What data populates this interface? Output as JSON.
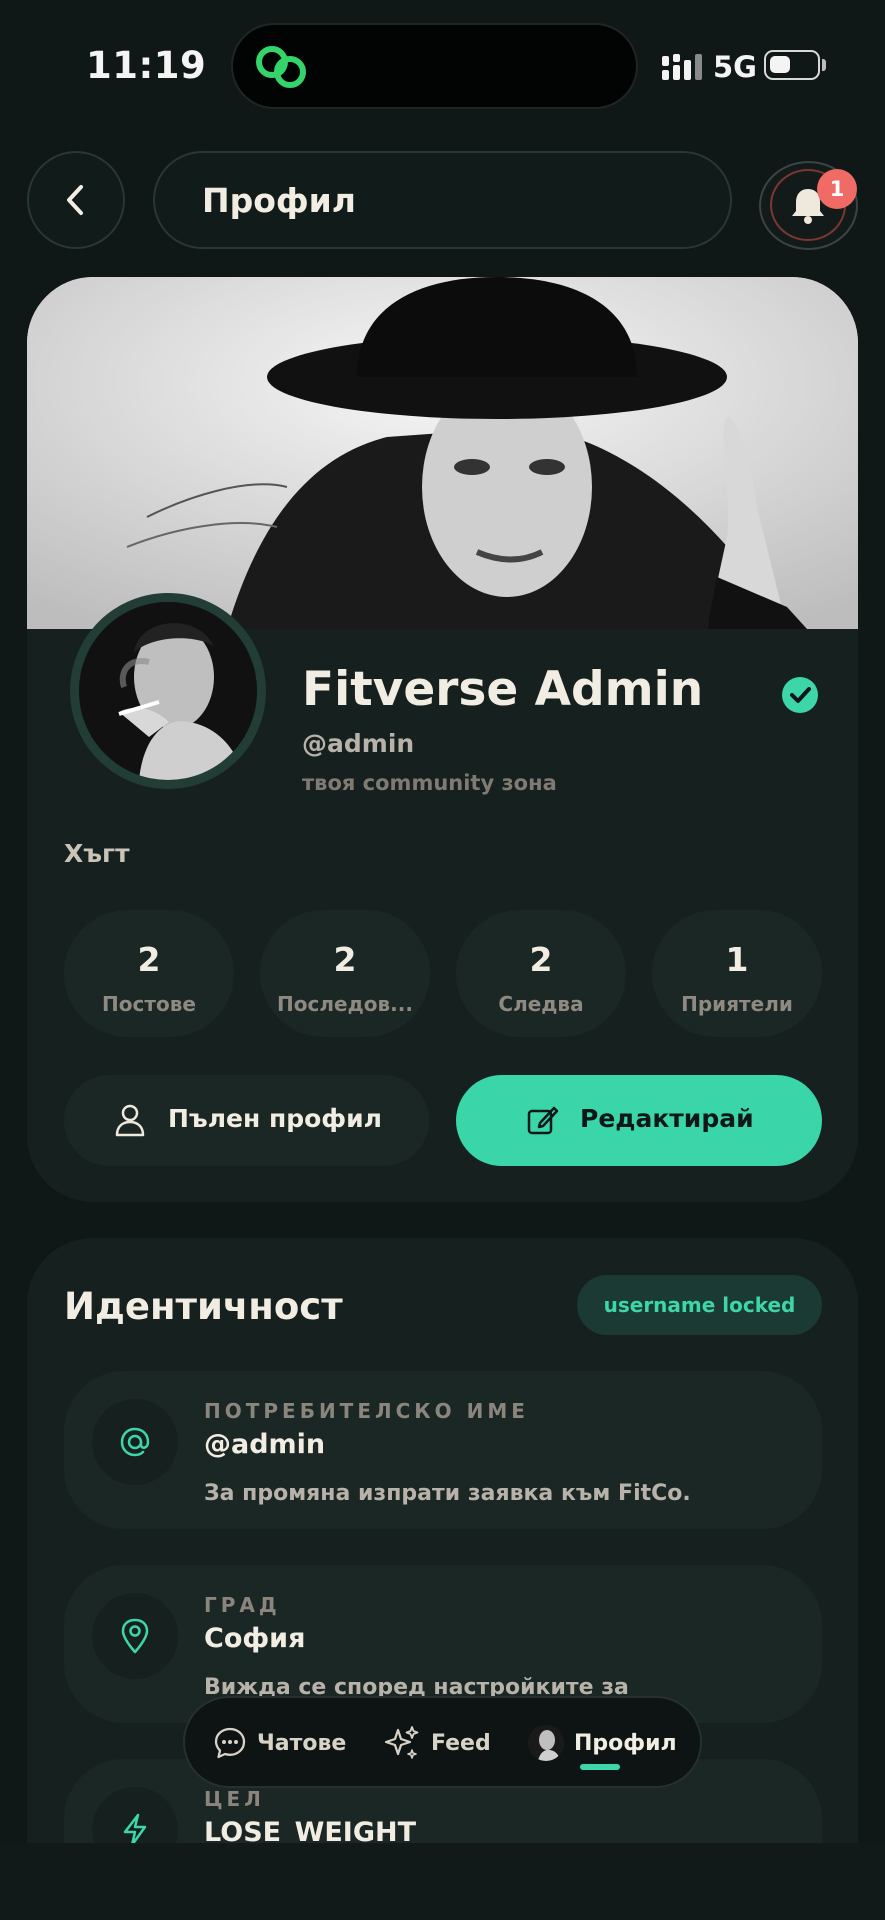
{
  "status_bar": {
    "time": "11:19",
    "network": "5G"
  },
  "header": {
    "title": "Профил",
    "notification_count": "1"
  },
  "profile": {
    "display_name": "Fitverse Admin",
    "handle": "@admin",
    "tagline": "твоя community зона",
    "bio": "Хъгт",
    "stats": [
      {
        "value": "2",
        "label": "Постове"
      },
      {
        "value": "2",
        "label": "Последов..."
      },
      {
        "value": "2",
        "label": "Следва"
      },
      {
        "value": "1",
        "label": "Приятели"
      }
    ],
    "full_profile_label": "Пълен профил",
    "edit_label": "Редактирай"
  },
  "identity": {
    "title": "Идентичност",
    "badge": "username locked",
    "items": [
      {
        "label": "ПОТРЕБИТЕЛСКО ИМЕ",
        "value": "@admin",
        "desc": "За промяна изпрати заявка към FitCo.",
        "icon": "at-icon"
      },
      {
        "label": "ГРАД",
        "value": "София",
        "desc": "Вижда се според настройките за поверителност.",
        "icon": "location-pin-icon"
      },
      {
        "label": "ЦЕЛ",
        "value": "LOSE_WEIGHT",
        "desc": "",
        "icon": "lightning-icon"
      }
    ]
  },
  "bottom_nav": {
    "items": [
      {
        "label": "Чатове",
        "icon": "chat-bubble-icon"
      },
      {
        "label": "Feed",
        "icon": "sparkles-icon"
      },
      {
        "label": "Профил",
        "icon": "avatar",
        "active": true
      }
    ]
  },
  "colors": {
    "accent": "#3dd6a8",
    "background": "#0f1817",
    "card": "#16211f",
    "badge": "#f06a66"
  }
}
